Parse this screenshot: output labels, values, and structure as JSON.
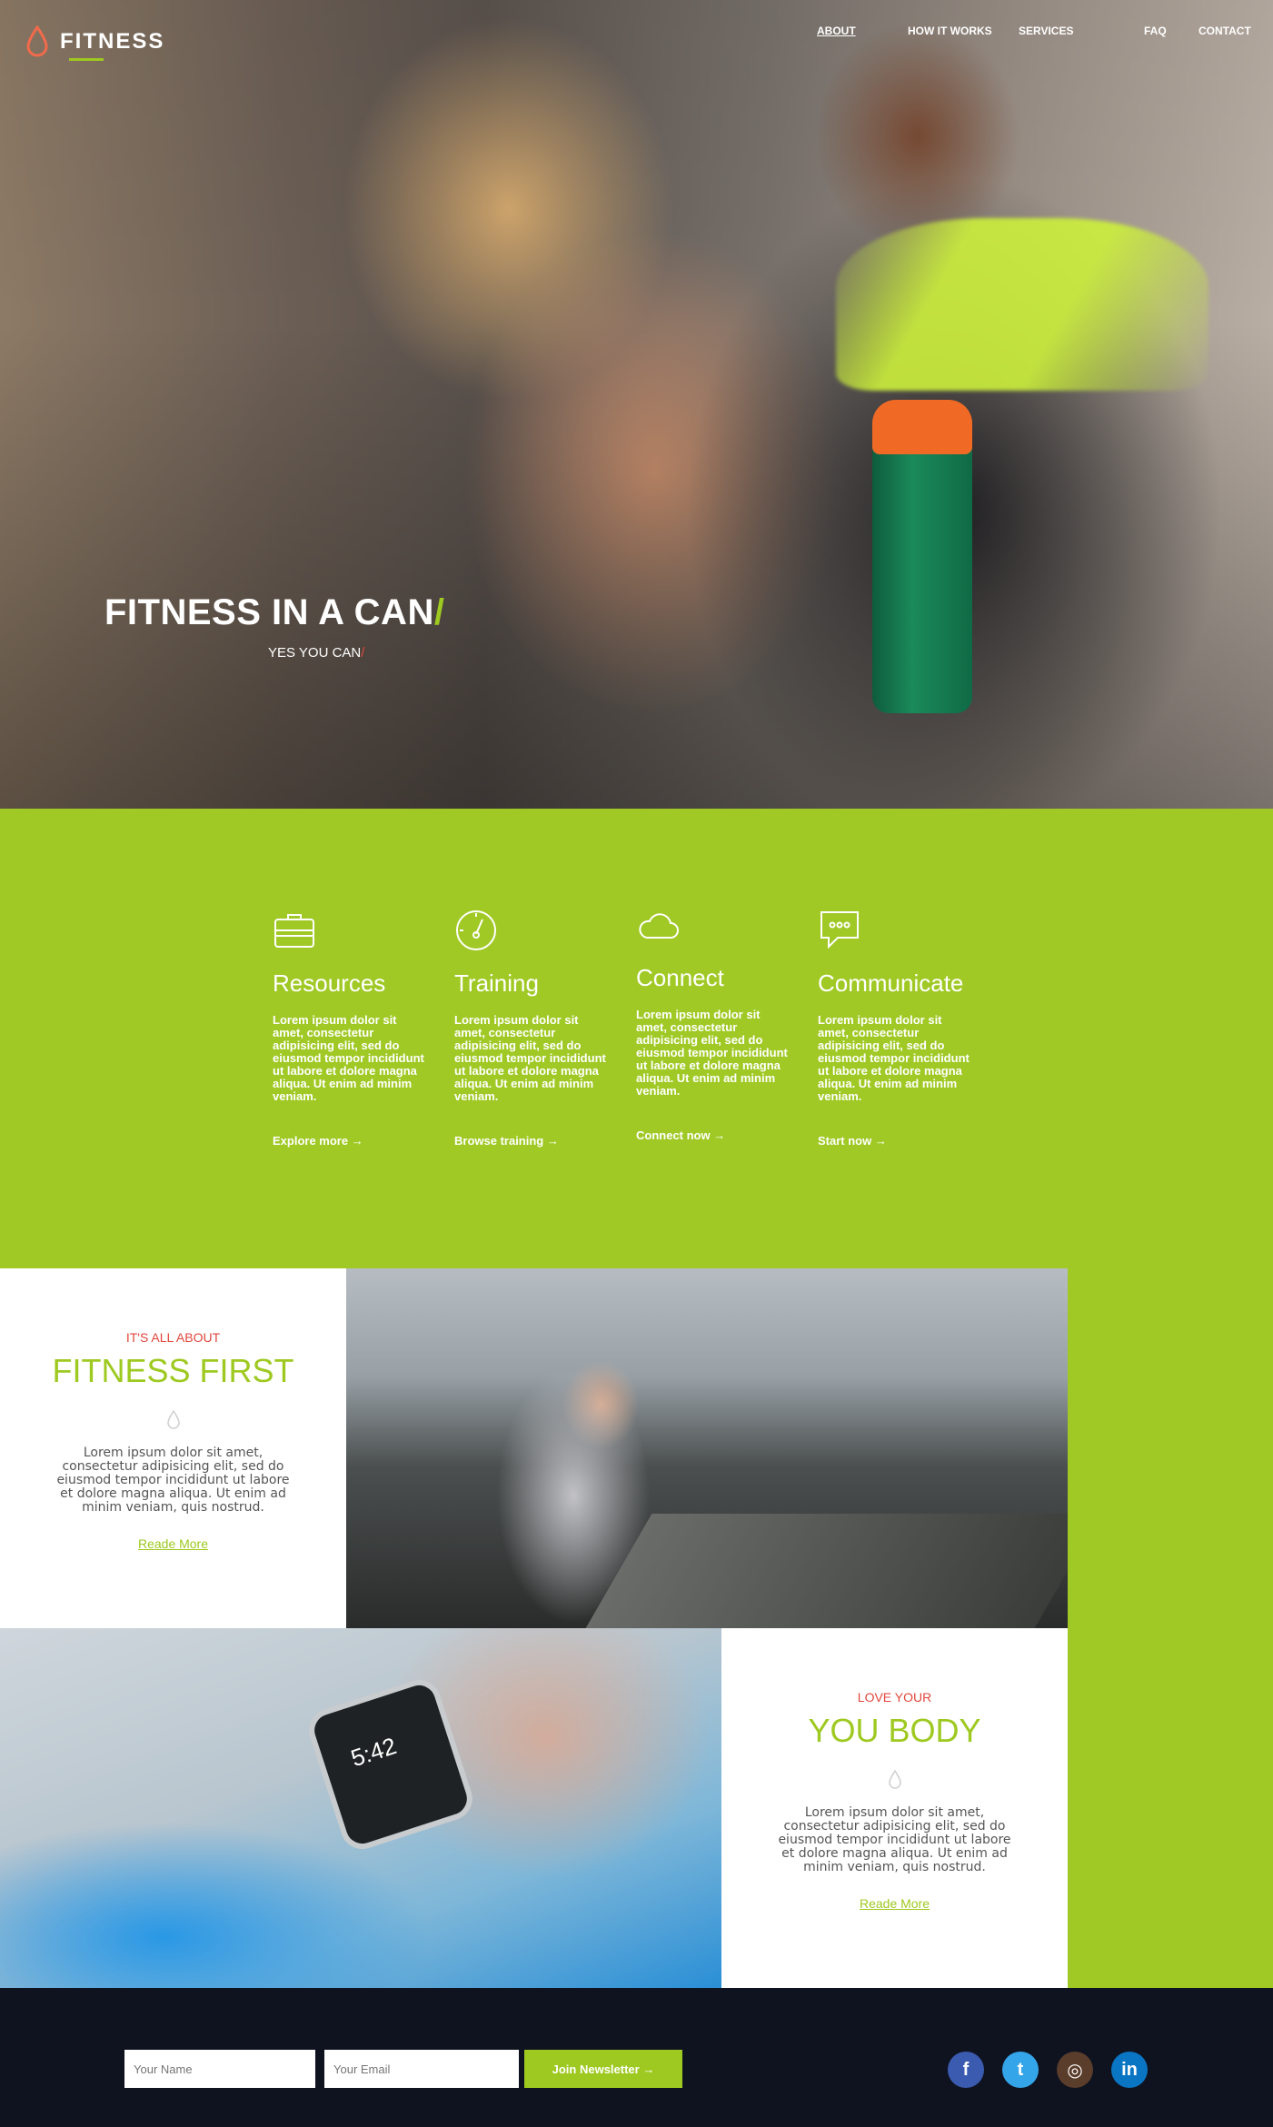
{
  "logo": {
    "text": "FITNESS"
  },
  "nav": {
    "items": [
      {
        "label": "ABOUT"
      },
      {
        "label": "HOW IT WORKS"
      },
      {
        "label": "SERVICES"
      },
      {
        "label": "FAQ"
      },
      {
        "label": "CONTACT"
      }
    ]
  },
  "hero": {
    "title": "FITNESS IN A CAN",
    "title_slash": "/",
    "subtitle": "YES YOU CAN",
    "subtitle_slash": "/"
  },
  "features": [
    {
      "icon": "briefcase-icon",
      "title": "Resources",
      "body": "Lorem ipsum dolor sit amet, consectetur adipisicing elit, sed do eiusmod tempor incididunt ut labore et dolore magna aliqua. Ut enim ad minim veniam.",
      "link": "Explore more →"
    },
    {
      "icon": "speedometer-icon",
      "title": "Training",
      "body": "Lorem ipsum dolor sit amet, consectetur adipisicing elit, sed do eiusmod tempor incididunt ut labore et dolore magna aliqua. Ut enim ad minim veniam.",
      "link": "Browse training →"
    },
    {
      "icon": "cloud-icon",
      "title": "Connect",
      "body": "Lorem ipsum dolor sit amet, consectetur adipisicing elit, sed do eiusmod tempor incididunt ut labore et dolore magna aliqua. Ut enim ad minim veniam.",
      "link": "Connect now →"
    },
    {
      "icon": "chat-bubble-icon",
      "title": "Communicate",
      "body": "Lorem ipsum dolor sit amet, consectetur adipisicing elit, sed do eiusmod tempor incididunt ut labore et dolore magna aliqua. Ut enim ad minim veniam.",
      "link": "Start now →"
    }
  ],
  "panel1": {
    "kicker": "IT'S ALL ABOUT",
    "title": "FITNESS FIRST",
    "body": "Lorem ipsum dolor sit amet, consectetur adipisicing elit, sed do eiusmod tempor incididunt ut labore et dolore magna aliqua. Ut enim ad minim veniam, quis nostrud.",
    "link": "Reade More"
  },
  "panel2": {
    "kicker": "LOVE YOUR",
    "title": "YOU BODY",
    "body": "Lorem ipsum dolor sit amet, consectetur adipisicing elit, sed do eiusmod tempor incididunt ut labore et dolore magna aliqua. Ut enim ad minim veniam, quis nostrud.",
    "link": "Reade More"
  },
  "watch": {
    "time": "5:42"
  },
  "footer": {
    "name_placeholder": "Your Name",
    "email_placeholder": "Your Email",
    "join_label": "Join Newsletter →",
    "social": [
      {
        "icon": "facebook-icon",
        "glyph": "f"
      },
      {
        "icon": "twitter-icon",
        "glyph": "t"
      },
      {
        "icon": "instagram-icon",
        "glyph": "◎"
      },
      {
        "icon": "linkedin-icon",
        "glyph": "in"
      }
    ]
  },
  "colors": {
    "accent_green": "#a0c925",
    "accent_red": "#e2463c",
    "footer_bg": "#0f1320"
  }
}
